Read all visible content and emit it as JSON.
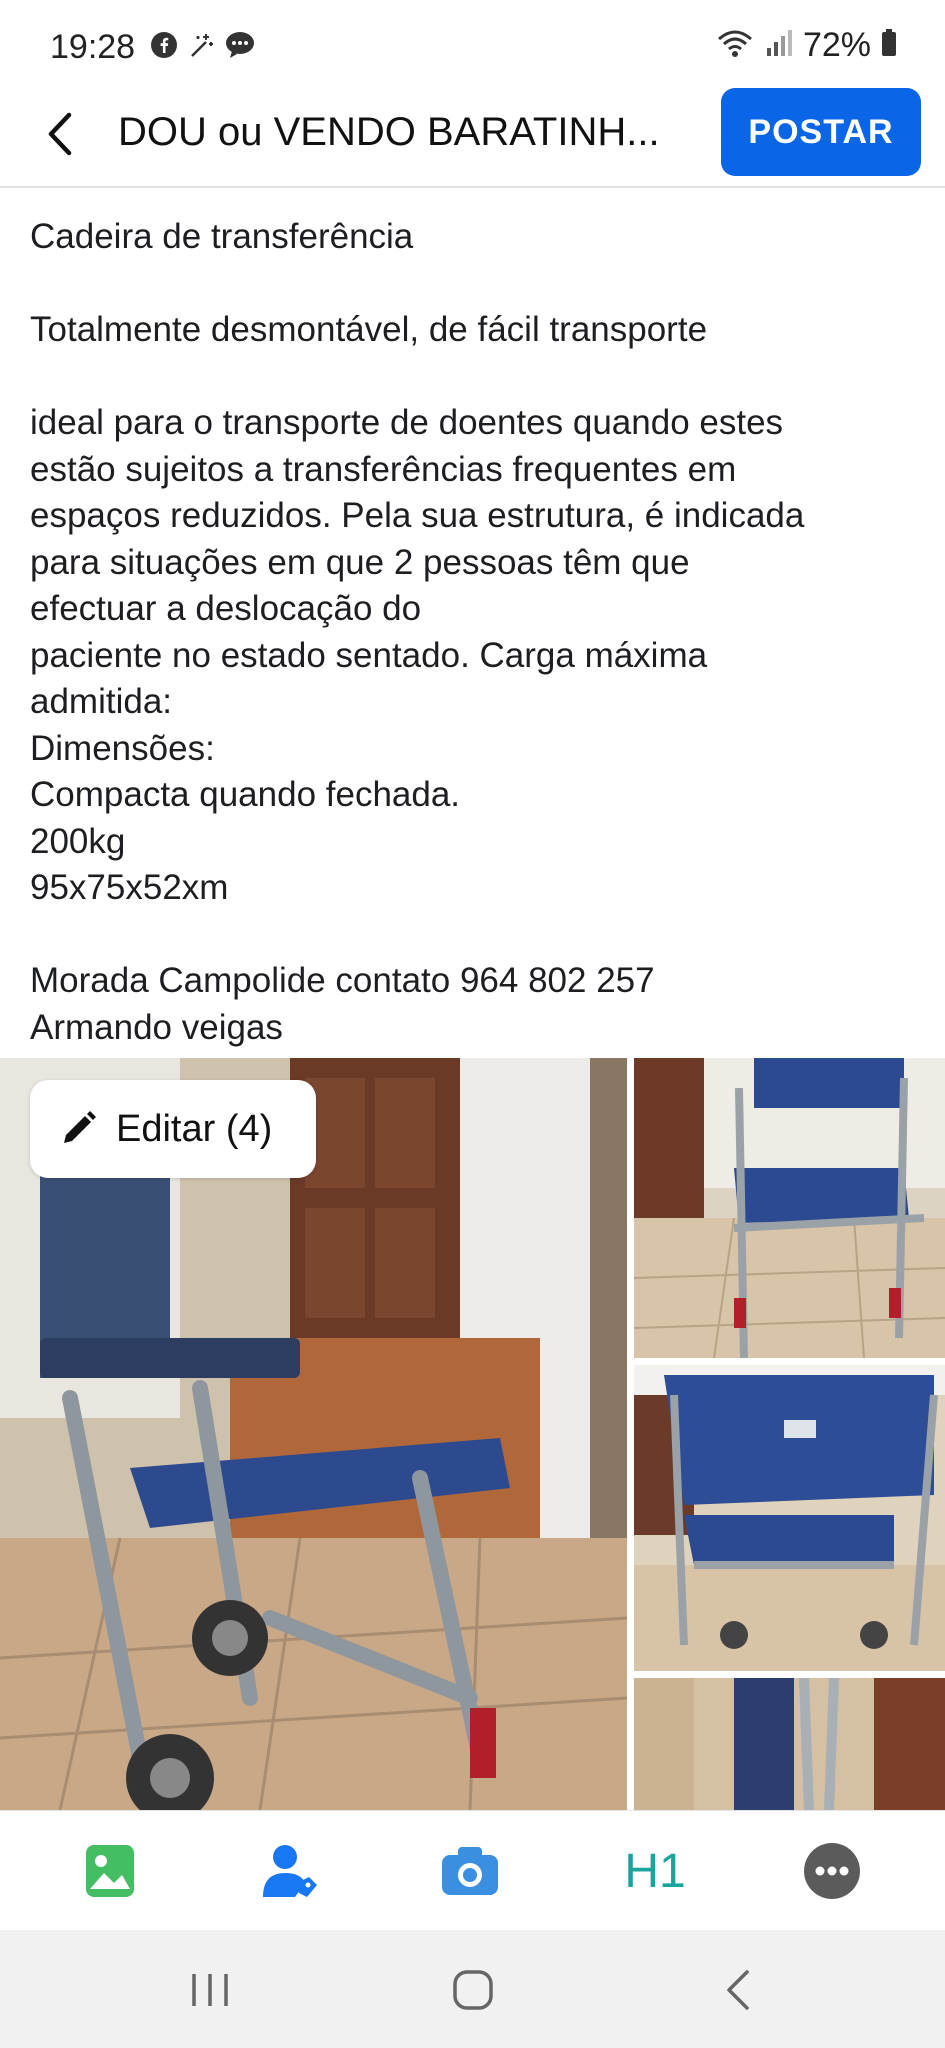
{
  "status_bar": {
    "time": "19:28",
    "battery": "72%",
    "icons_left": [
      "facebook-icon",
      "sparkle-icon",
      "messenger-icon"
    ],
    "icons_right": [
      "wifi-icon",
      "signal-icon",
      "battery-icon"
    ]
  },
  "header": {
    "title": "DOU ou VENDO BARATINH...",
    "post_button": "POSTAR"
  },
  "post": {
    "title_line": "Cadeira de transferência",
    "subtitle_line": "Totalmente desmontável, de fácil transporte",
    "description_lines": [
      "ideal para o transporte de doentes quando estes",
      "estão sujeitos a transferências frequentes em",
      "espaços reduzidos. Pela sua estrutura, é indicada",
      "para situações em que 2 pessoas têm que",
      "efectuar a deslocação do",
      "paciente no estado sentado. Carga máxima",
      "admitida:",
      "Dimensões:",
      "Compacta quando fechada.",
      "200kg",
      "95x75x52xm"
    ],
    "contact_line": "Morada  Campolide  contato  964 802 257",
    "name_line": "Armando veigas"
  },
  "photos": {
    "edit_button": "Editar (4)",
    "count": 4
  },
  "toolbar": {
    "h1_label": "H1",
    "items": [
      "photo-icon",
      "tag-people-icon",
      "camera-icon",
      "heading-icon",
      "more-icon"
    ]
  },
  "colors": {
    "accent": "#0a66e6",
    "photo_green": "#45bd62",
    "tag_blue": "#1877f2",
    "camera_blue": "#3b8fe0",
    "h1_teal": "#1aa59c",
    "more_gray": "#5b5b5b"
  }
}
